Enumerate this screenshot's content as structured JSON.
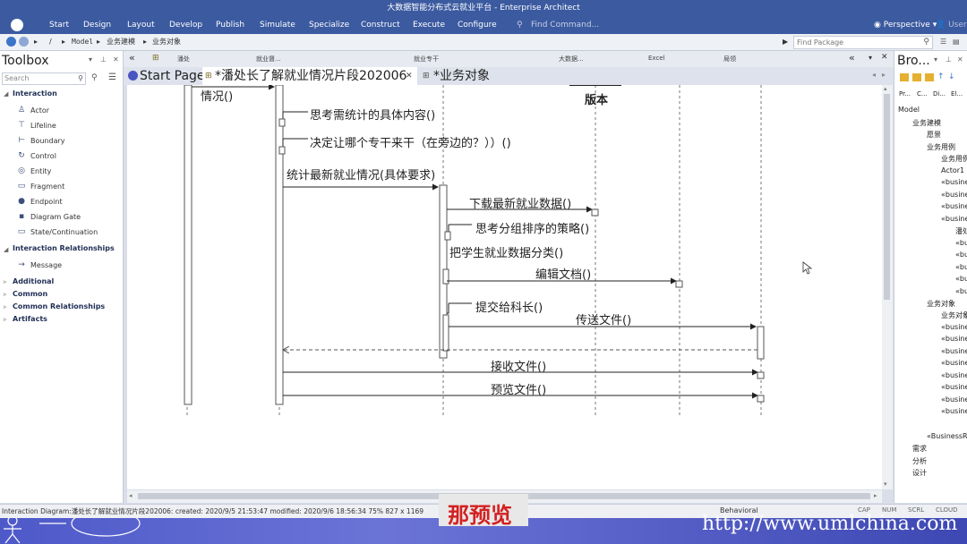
{
  "window_title": "大数据智能分布式云就业平台 - Enterprise Architect",
  "ribbon": {
    "menus": [
      "Start",
      "Design",
      "Layout",
      "Develop",
      "Publish",
      "Simulate",
      "Specialize",
      "Construct",
      "Execute",
      "Configure"
    ],
    "find_command": "Find Command...",
    "perspective": "Perspective",
    "user": "User"
  },
  "nav": {
    "path": [
      "Model",
      "业务建模",
      "业务对象"
    ],
    "find_package": "Find Package"
  },
  "toolbox": {
    "title": "Toolbox",
    "search_placeholder": "Search",
    "interaction": "Interaction",
    "items": [
      "Actor",
      "Lifeline",
      "Boundary",
      "Control",
      "Entity",
      "Fragment",
      "Endpoint",
      "Diagram Gate",
      "State/Continuation"
    ],
    "relationships": "Interaction Relationships",
    "message": "Message",
    "additional": "Additional",
    "common": "Common",
    "common_rel": "Common Relationships",
    "artifacts": "Artifacts"
  },
  "lifeline_headers": [
    "潘处",
    "就业督...",
    "就业专干",
    "大数据...",
    "Excel",
    "局领"
  ],
  "tabs": [
    "Start Page",
    "*潘处长了解就业情况片段202006",
    "*业务对象"
  ],
  "diagram": {
    "header_label": "版本",
    "messages": [
      "情况()",
      "思考需统计的具体内容()",
      "决定让哪个专干来干（在旁边的？））()",
      "统计最新就业情况(具体要求)",
      "下载最新就业数据()",
      "思考分组排序的策略()",
      "把学生就业数据分类()",
      "编辑文档()",
      "提交给科长()",
      "传送文件()",
      "接收文件()",
      "预览文件()"
    ]
  },
  "browser": {
    "title": "Bro...",
    "tabs": [
      "Pr...",
      "C...",
      "Di...",
      "El..."
    ],
    "tree": [
      "Model",
      "业务建模",
      "愿景",
      "业务用例",
      "业务用例",
      "Actor1",
      "«busine",
      "«busine",
      "«busine",
      "«busine",
      "潘处",
      "«bu",
      "«bu",
      "«bu",
      "«bu",
      "«bu",
      "业务对象",
      "业务对象",
      "«busine",
      "«busine",
      "«busine",
      "«busine",
      "«busine",
      "«busine",
      "«busine",
      "«busine",
      "«BusinessR",
      "需求",
      "分析",
      "设计"
    ]
  },
  "status": {
    "left": "Interaction Diagram:潘处长了解就业情况片段202006:  created: 2020/9/5 21:53:47  modified: 2020/9/6 18:56:34   75%   827 x 1169",
    "mode": "Behavioral",
    "indicators": [
      "CAP",
      "NUM",
      "SCRL",
      "CLOUD"
    ]
  },
  "overlay": {
    "subtitle": "那预览",
    "url": "http://www.umlchina.com"
  }
}
